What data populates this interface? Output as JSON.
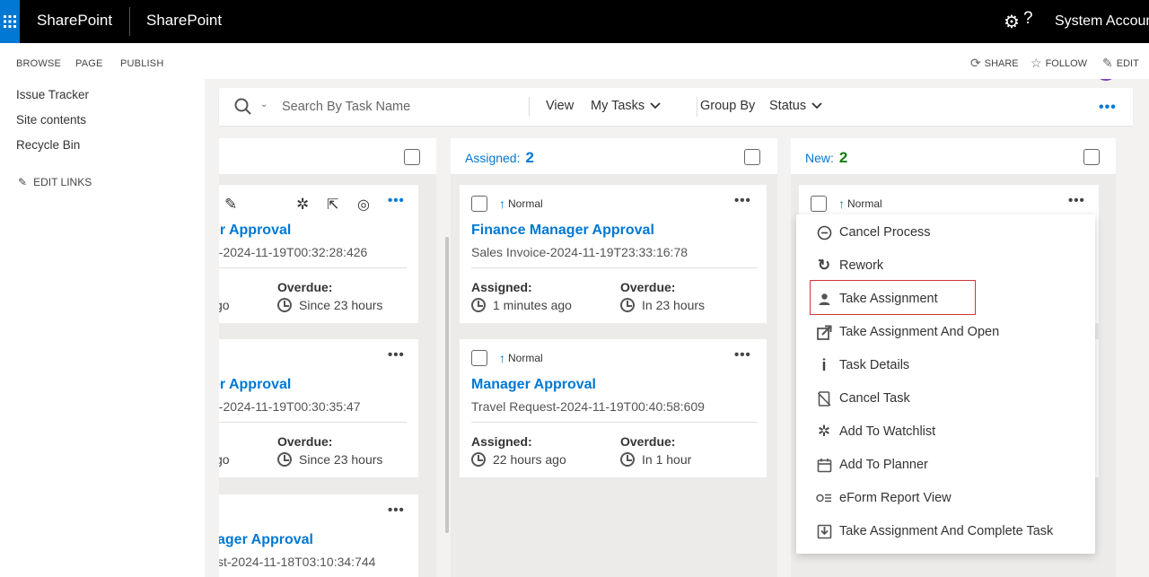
{
  "suite_bar": {
    "brand": "SharePoint",
    "site_title": "SharePoint",
    "user": "System Account",
    "accent": "#0078d4"
  },
  "ribbon": {
    "tabs": [
      "BROWSE",
      "PAGE",
      "PUBLISH"
    ],
    "actions": [
      {
        "label": "SHARE",
        "icon": "share-icon"
      },
      {
        "label": "FOLLOW",
        "icon": "star-icon"
      },
      {
        "label": "EDIT",
        "icon": "pencil-icon"
      }
    ]
  },
  "left_nav": {
    "links": [
      "Issue Tracker",
      "Site contents",
      "Recycle Bin"
    ],
    "edit_links": "EDIT LINKS"
  },
  "toolbar": {
    "search_placeholder": "Search By Task Name",
    "view_label": "View",
    "view_value": "My Tasks",
    "group_label": "Group By",
    "group_value": "Status"
  },
  "columns": {
    "assigned": {
      "label": "Assigned:",
      "count": "2",
      "count_color": "#0078d4"
    },
    "new": {
      "label": "New:",
      "count": "2",
      "count_color": "#107c10"
    }
  },
  "cards": {
    "c1": {
      "title": "er Approval",
      "subtitle": "n-2024-11-19T00:32:28:426",
      "assigned_value": "go",
      "overdue_label": "Overdue:",
      "overdue_value": "Since 23 hours"
    },
    "c2": {
      "title": "er Approval",
      "subtitle": "n-2024-11-19T00:30:35:47",
      "assigned_value": "go",
      "overdue_label": "Overdue:",
      "overdue_value": "Since 23 hours"
    },
    "c3": {
      "title": "ager Approval",
      "subtitle": "st-2024-11-18T03:10:34:744"
    },
    "a1": {
      "priority": "Normal",
      "title": "Finance Manager Approval",
      "subtitle": "Sales Invoice-2024-11-19T23:33:16:78",
      "assigned_label": "Assigned:",
      "assigned_value": "1 minutes ago",
      "overdue_label": "Overdue:",
      "overdue_value": "In 23 hours"
    },
    "a2": {
      "priority": "Normal",
      "title": "Manager Approval",
      "subtitle": "Travel Request-2024-11-19T00:40:58:609",
      "assigned_label": "Assigned:",
      "assigned_value": "22 hours ago",
      "overdue_label": "Overdue:",
      "overdue_value": "In 1 hour"
    },
    "n1": {
      "priority": "Normal"
    }
  },
  "context_menu": {
    "items": [
      {
        "label": "Cancel Process",
        "icon": "minus-circle-icon"
      },
      {
        "label": "Rework",
        "icon": "refresh-icon"
      },
      {
        "label": "Take Assignment",
        "icon": "person-icon",
        "highlighted": true
      },
      {
        "label": "Take Assignment And Open",
        "icon": "open-external-icon"
      },
      {
        "label": "Task Details",
        "icon": "info-icon"
      },
      {
        "label": "Cancel Task",
        "icon": "cancel-task-icon"
      },
      {
        "label": "Add To Watchlist",
        "icon": "watch-icon"
      },
      {
        "label": "Add To Planner",
        "icon": "calendar-icon"
      },
      {
        "label": "eForm Report View",
        "icon": "report-icon"
      },
      {
        "label": "Take Assignment And Complete Task",
        "icon": "complete-task-icon"
      }
    ],
    "highlight_color": "#d13438"
  }
}
